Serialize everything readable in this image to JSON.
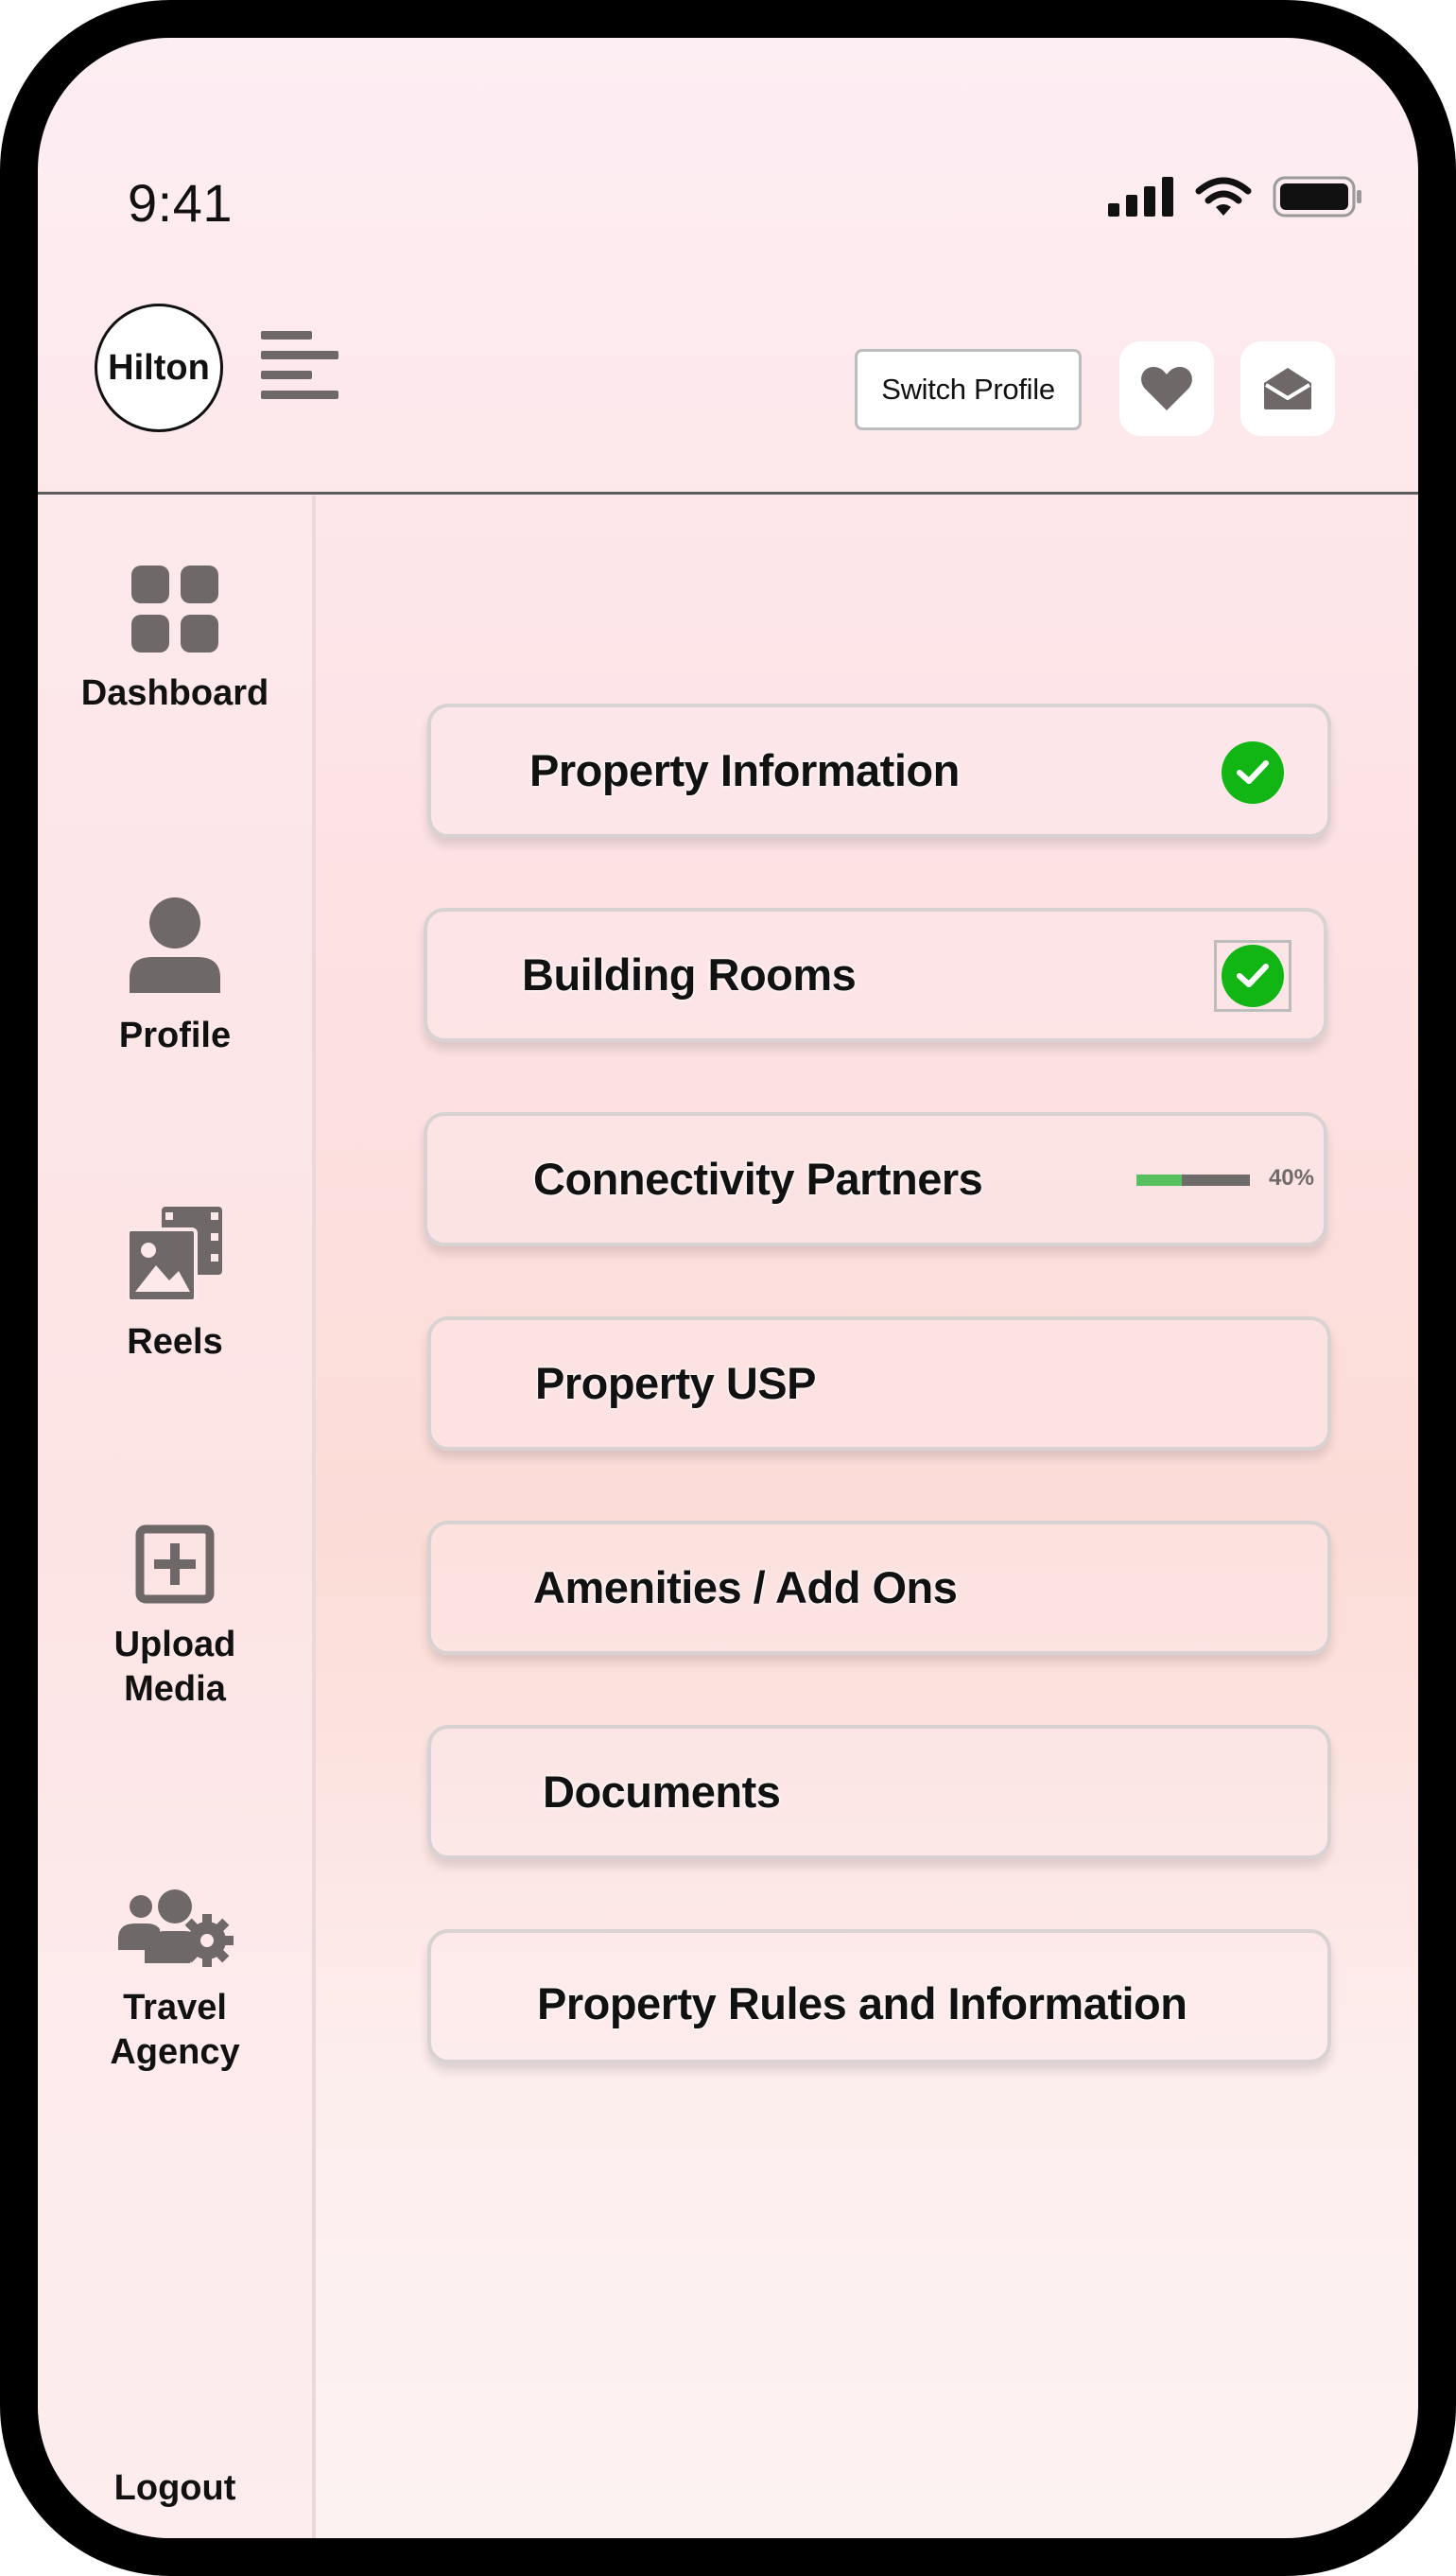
{
  "status_bar": {
    "time": "9:41"
  },
  "header": {
    "logo_text": "Hilton",
    "switch_profile_label": "Switch Profile"
  },
  "sidebar": {
    "items": [
      {
        "label": "Dashboard",
        "icon": "dashboard-grid-icon"
      },
      {
        "label": "Profile",
        "icon": "user-icon"
      },
      {
        "label": "Reels",
        "icon": "reels-gallery-icon"
      },
      {
        "label": "Upload\nMedia",
        "icon": "plus-square-icon"
      },
      {
        "label": "Travel\nAgency",
        "icon": "users-gear-icon"
      }
    ],
    "logout_label": "Logout"
  },
  "sections": [
    {
      "label": "Property Information",
      "status": "complete"
    },
    {
      "label": "Building Rooms",
      "status": "complete"
    },
    {
      "label": "Connectivity Partners",
      "status": "in-progress",
      "progress": 0.4,
      "progress_text": "40%"
    },
    {
      "label": "Property USP"
    },
    {
      "label": "Amenities / Add Ons"
    },
    {
      "label": "Documents"
    },
    {
      "label": "Property Rules and Information"
    }
  ],
  "colors": {
    "success": "#12b614",
    "progress_fill": "#58c05e",
    "icon_gray": "#6f6868",
    "screen_background": "#fde3e6"
  }
}
